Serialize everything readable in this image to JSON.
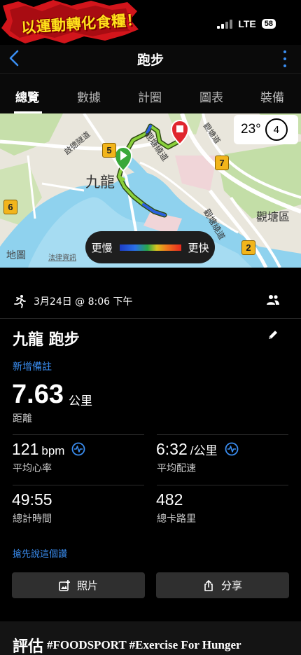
{
  "status": {
    "logo_text": "以運動轉化食糧！",
    "network": "LTE",
    "battery": "58"
  },
  "nav": {
    "title": "跑步"
  },
  "tabs": [
    {
      "label": "總覽",
      "active": true
    },
    {
      "label": "數據",
      "active": false
    },
    {
      "label": "計圈",
      "active": false
    },
    {
      "label": "圖表",
      "active": false
    },
    {
      "label": "裝備",
      "active": false
    }
  ],
  "map": {
    "labels": {
      "kowloon": "九龍",
      "kwun_tong": "觀塘區",
      "road_1": "觀塘繞道",
      "road_2": "觀塘繞道",
      "road_3": "啟德隧道",
      "road_4": "觀塘道"
    },
    "route_badges": [
      "5",
      "6",
      "7",
      "2"
    ],
    "weather": {
      "temperature": "23°",
      "wind": "4"
    },
    "pace_legend": {
      "slow": "更慢",
      "fast": "更快"
    },
    "apple_maps": "地圖",
    "legal": "法律資訊"
  },
  "activity": {
    "date_time": "3月24日 @ 8:06 下午",
    "title": "九龍 跑步",
    "add_note": "新增備註",
    "distance": {
      "value": "7.63",
      "unit": "公里",
      "label": "距離"
    },
    "avg_hr": {
      "value": "121",
      "unit": "bpm",
      "label": "平均心率"
    },
    "avg_pace": {
      "value": "6:32",
      "unit": "/公里",
      "label": "平均配速"
    },
    "total_time": {
      "value": "49:55",
      "label": "總計時間"
    },
    "calories": {
      "value": "482",
      "label": "總卡路里"
    },
    "first_comment": "搶先說這個讚",
    "photo_button": "照片",
    "share_button": "分享"
  },
  "evaluation": {
    "title": "評估",
    "hashtags": "#FOODSPORT #Exercise For Hunger"
  },
  "colors": {
    "accent_blue": "#3a8df0",
    "logo_yellow": "#ffe11a",
    "logo_red": "#d2151b",
    "route_green": "#8ad13b",
    "route_blue": "#2a5fe0",
    "start_green": "#3aa83a",
    "end_red": "#e0262e"
  }
}
